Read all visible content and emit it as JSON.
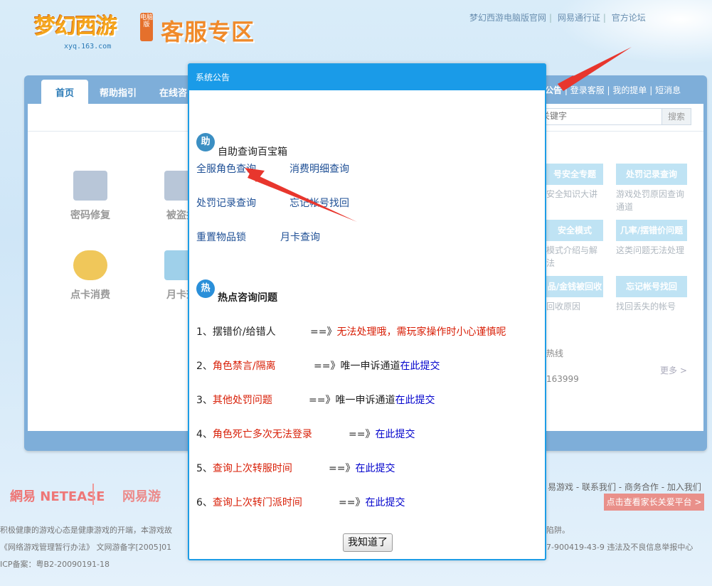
{
  "header": {
    "logo_text": "梦幻西游",
    "logo_domain": "xyq.163.com",
    "logo_badge": "电脑版",
    "zone_title": "客服专区",
    "top_links": [
      "梦幻西游电脑版官网",
      "网易通行证",
      "官方论坛"
    ]
  },
  "nav": {
    "tabs": [
      "首页",
      "帮助指引",
      "在线咨"
    ],
    "right_items": [
      "公告",
      "登录客服",
      "我的提单",
      "短消息"
    ]
  },
  "search": {
    "placeholder": "号/关键字",
    "button": "搜索"
  },
  "tools": [
    {
      "label": "密码修复"
    },
    {
      "label": "被盗找"
    },
    {
      "label": "点卡消费"
    },
    {
      "label": "月卡查"
    }
  ],
  "right_cards": [
    {
      "title": "号安全专题",
      "desc": "安全知识大讲"
    },
    {
      "title": "处罚记录查询",
      "desc": "游戏处罚原因查询通道"
    },
    {
      "title": "安全模式",
      "desc": "模式介绍与解法"
    },
    {
      "title": "几率/摆错价问题",
      "desc": "这类问题无法处理"
    },
    {
      "title": "品/金钱被回收",
      "desc": "回收原因"
    },
    {
      "title": "忘记帐号找回",
      "desc": "找回丢失的帐号"
    }
  ],
  "hotline": {
    "label": "热线",
    "number": "163999",
    "more": "更多 >"
  },
  "footer": {
    "logo_netease": "網易 NETEASE",
    "logo_netease_game": "网易游",
    "links": "易游戏 - 联系我们 - 商务合作 - 加入我们",
    "parent_button": "点击查看家长关爱平台 >",
    "line1": "积极健康的游戏心态是健康游戏的开端，本游戏故",
    "line1_end": "陷阱。",
    "line2": "《网络游戏管理暂行办法》 文网游备字[2005]01",
    "line2_end": "7-900419-43-9 违法及不良信息举报中心",
    "line3": "ICP备案：粤B2-20090191-18"
  },
  "modal": {
    "title": "系统公告",
    "help_icon": "助",
    "help_heading": "自助查询百宝箱",
    "links_row1": [
      "全服角色查询",
      "消费明细查询"
    ],
    "links_row2": [
      "处罚记录查询",
      "忘记帐号找回"
    ],
    "links_row3": [
      "重置物品锁",
      "月卡查询"
    ],
    "hot_icon": "热",
    "hot_heading": "热点咨询问题",
    "faq": [
      {
        "num": "1、",
        "q": "摆错价/给错人",
        "arrow": "==》",
        "a": "无法处理哦，需玩家操作时小心谨慎呢",
        "a_class": "red",
        "link": ""
      },
      {
        "num": "2、",
        "q": "角色禁言/隔离",
        "arrow": "==》",
        "a": "唯一申诉通道",
        "a_class": "",
        "link": "在此提交"
      },
      {
        "num": "3、",
        "q": "其他处罚问题",
        "arrow": "==》",
        "a": "唯一申诉通道",
        "a_class": "",
        "link": "在此提交"
      },
      {
        "num": "4、",
        "q": "角色死亡多次无法登录",
        "arrow": "==》",
        "a": "",
        "a_class": "",
        "link": "在此提交"
      },
      {
        "num": "5、",
        "q": "查询上次转服时间",
        "arrow": "==》",
        "a": "",
        "a_class": "",
        "link": "在此提交"
      },
      {
        "num": "6、",
        "q": "查询上次转门派时间",
        "arrow": "==》",
        "a": "",
        "a_class": "",
        "link": "在此提交"
      }
    ],
    "ok_button": "我知道了"
  },
  "colors": {
    "modal_header": "#1a9be8",
    "annotation_arrow": "#e8362d",
    "panel": "#7eaed9"
  }
}
